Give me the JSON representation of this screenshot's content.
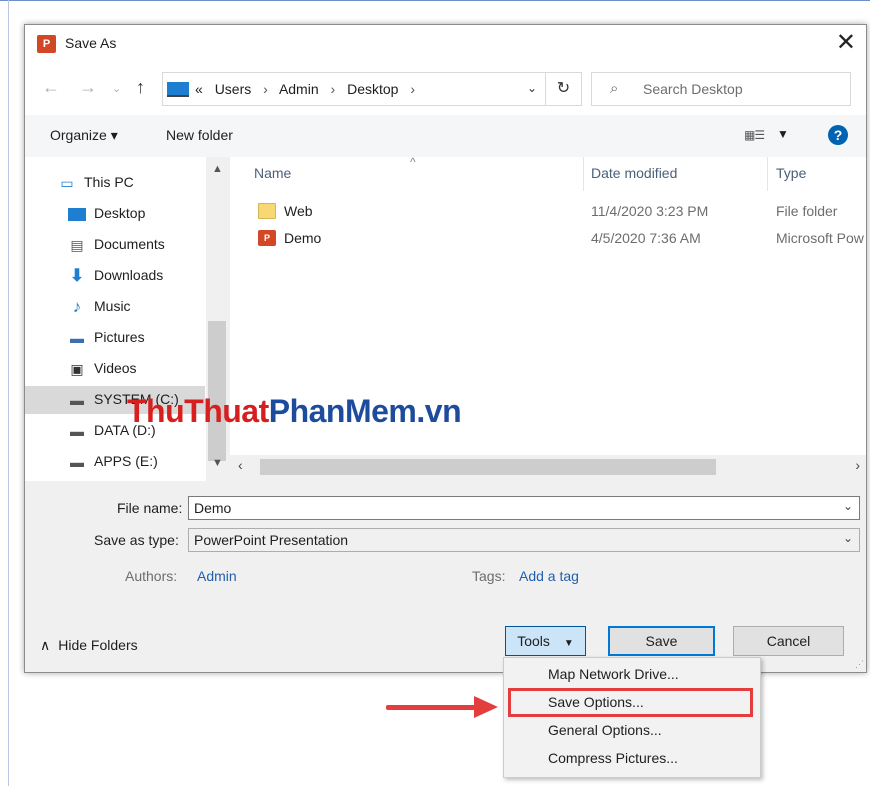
{
  "window": {
    "title": "Save As",
    "app_icon": "P"
  },
  "address_bar": {
    "overflow": "«",
    "crumbs": [
      "Users",
      "Admin",
      "Desktop"
    ]
  },
  "search": {
    "placeholder": "Search Desktop"
  },
  "toolbar": {
    "organize": "Organize ▾",
    "new_folder": "New folder"
  },
  "sidebar": {
    "items": [
      {
        "label": "This PC",
        "icon": "computer-icon"
      },
      {
        "label": "Desktop",
        "icon": "desktop-icon"
      },
      {
        "label": "Documents",
        "icon": "document-icon"
      },
      {
        "label": "Downloads",
        "icon": "download-arrow-icon"
      },
      {
        "label": "Music",
        "icon": "music-note-icon"
      },
      {
        "label": "Pictures",
        "icon": "picture-icon"
      },
      {
        "label": "Videos",
        "icon": "film-icon"
      },
      {
        "label": "SYSTEM (C:)",
        "icon": "drive-icon",
        "selected": true
      },
      {
        "label": "DATA (D:)",
        "icon": "drive-icon"
      },
      {
        "label": "APPS (E:)",
        "icon": "drive-icon"
      }
    ]
  },
  "file_list": {
    "columns": [
      "Name",
      "Date modified",
      "Type"
    ],
    "rows": [
      {
        "name": "Web",
        "date": "11/4/2020 3:23 PM",
        "type": "File folder",
        "icon": "folder-icon"
      },
      {
        "name": "Demo",
        "date": "4/5/2020 7:36 AM",
        "type": "Microsoft Pow",
        "icon": "powerpoint-file-icon"
      }
    ]
  },
  "watermark": {
    "part1": "ThuThuat",
    "part2": "PhanMem",
    "part3": ".vn"
  },
  "form": {
    "file_name_label": "File name:",
    "file_name_value": "Demo",
    "save_type_label": "Save as type:",
    "save_type_value": "PowerPoint Presentation",
    "authors_label": "Authors:",
    "authors_value": "Admin",
    "tags_label": "Tags:",
    "tags_value": "Add a tag"
  },
  "footer": {
    "hide_folders": "Hide Folders",
    "tools": "Tools",
    "save": "Save",
    "cancel": "Cancel"
  },
  "tools_menu": {
    "items": [
      "Map Network Drive...",
      "Save Options...",
      "General Options...",
      "Compress Pictures..."
    ],
    "highlighted_index": 1
  },
  "colors": {
    "annotation": "#e43d3d",
    "accent": "#0078d7",
    "link": "#1f5fad"
  }
}
